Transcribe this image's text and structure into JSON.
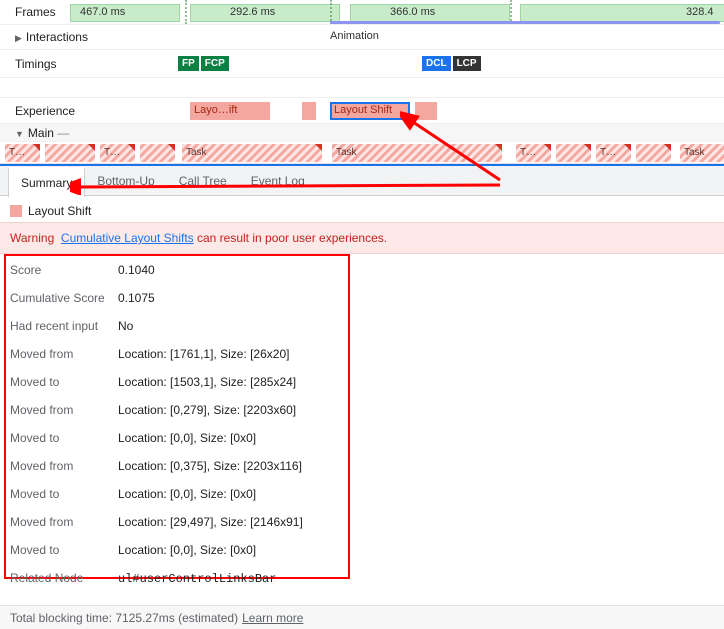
{
  "rows": {
    "frames_label": "Frames",
    "interactions_label": "Interactions",
    "timings_label": "Timings",
    "experience_label": "Experience",
    "main_label": "Main"
  },
  "frames": {
    "v0": "467.0 ms",
    "v1": "292.6 ms",
    "v2": "366.0 ms",
    "v3": "328.4"
  },
  "anim": {
    "label": "Animation"
  },
  "timings": {
    "fp": "FP",
    "fcp": "FCP",
    "dcl": "DCL",
    "lcp": "LCP"
  },
  "exp": {
    "b1": "Layo…ift",
    "b2": "Layout Shift"
  },
  "tasks": {
    "t": "T…",
    "task": "Task"
  },
  "tabs": {
    "summary": "Summary",
    "bottomup": "Bottom-Up",
    "calltree": "Call Tree",
    "eventlog": "Event Log"
  },
  "summary": {
    "title": "Layout Shift"
  },
  "warning": {
    "label": "Warning",
    "link": "Cumulative Layout Shifts",
    "rest": " can result in poor user experiences."
  },
  "details": [
    {
      "k": "Score",
      "v": "0.1040"
    },
    {
      "k": "Cumulative Score",
      "v": "0.1075"
    },
    {
      "k": "Had recent input",
      "v": "No"
    },
    {
      "k": "Moved from",
      "v": "Location: [1761,1], Size: [26x20]"
    },
    {
      "k": "Moved to",
      "v": "Location: [1503,1], Size: [285x24]"
    },
    {
      "k": "Moved from",
      "v": "Location: [0,279], Size: [2203x60]"
    },
    {
      "k": "Moved to",
      "v": "Location: [0,0], Size: [0x0]"
    },
    {
      "k": "Moved from",
      "v": "Location: [0,375], Size: [2203x116]"
    },
    {
      "k": "Moved to",
      "v": "Location: [0,0], Size: [0x0]"
    },
    {
      "k": "Moved from",
      "v": "Location: [29,497], Size: [2146x91]"
    },
    {
      "k": "Moved to",
      "v": "Location: [0,0], Size: [0x0]"
    }
  ],
  "related": {
    "k": "Related Node",
    "v": "ul#userControlLinksBar"
  },
  "footer": {
    "text": "Total blocking time: 7125.27ms (estimated)",
    "link": "Learn more"
  }
}
